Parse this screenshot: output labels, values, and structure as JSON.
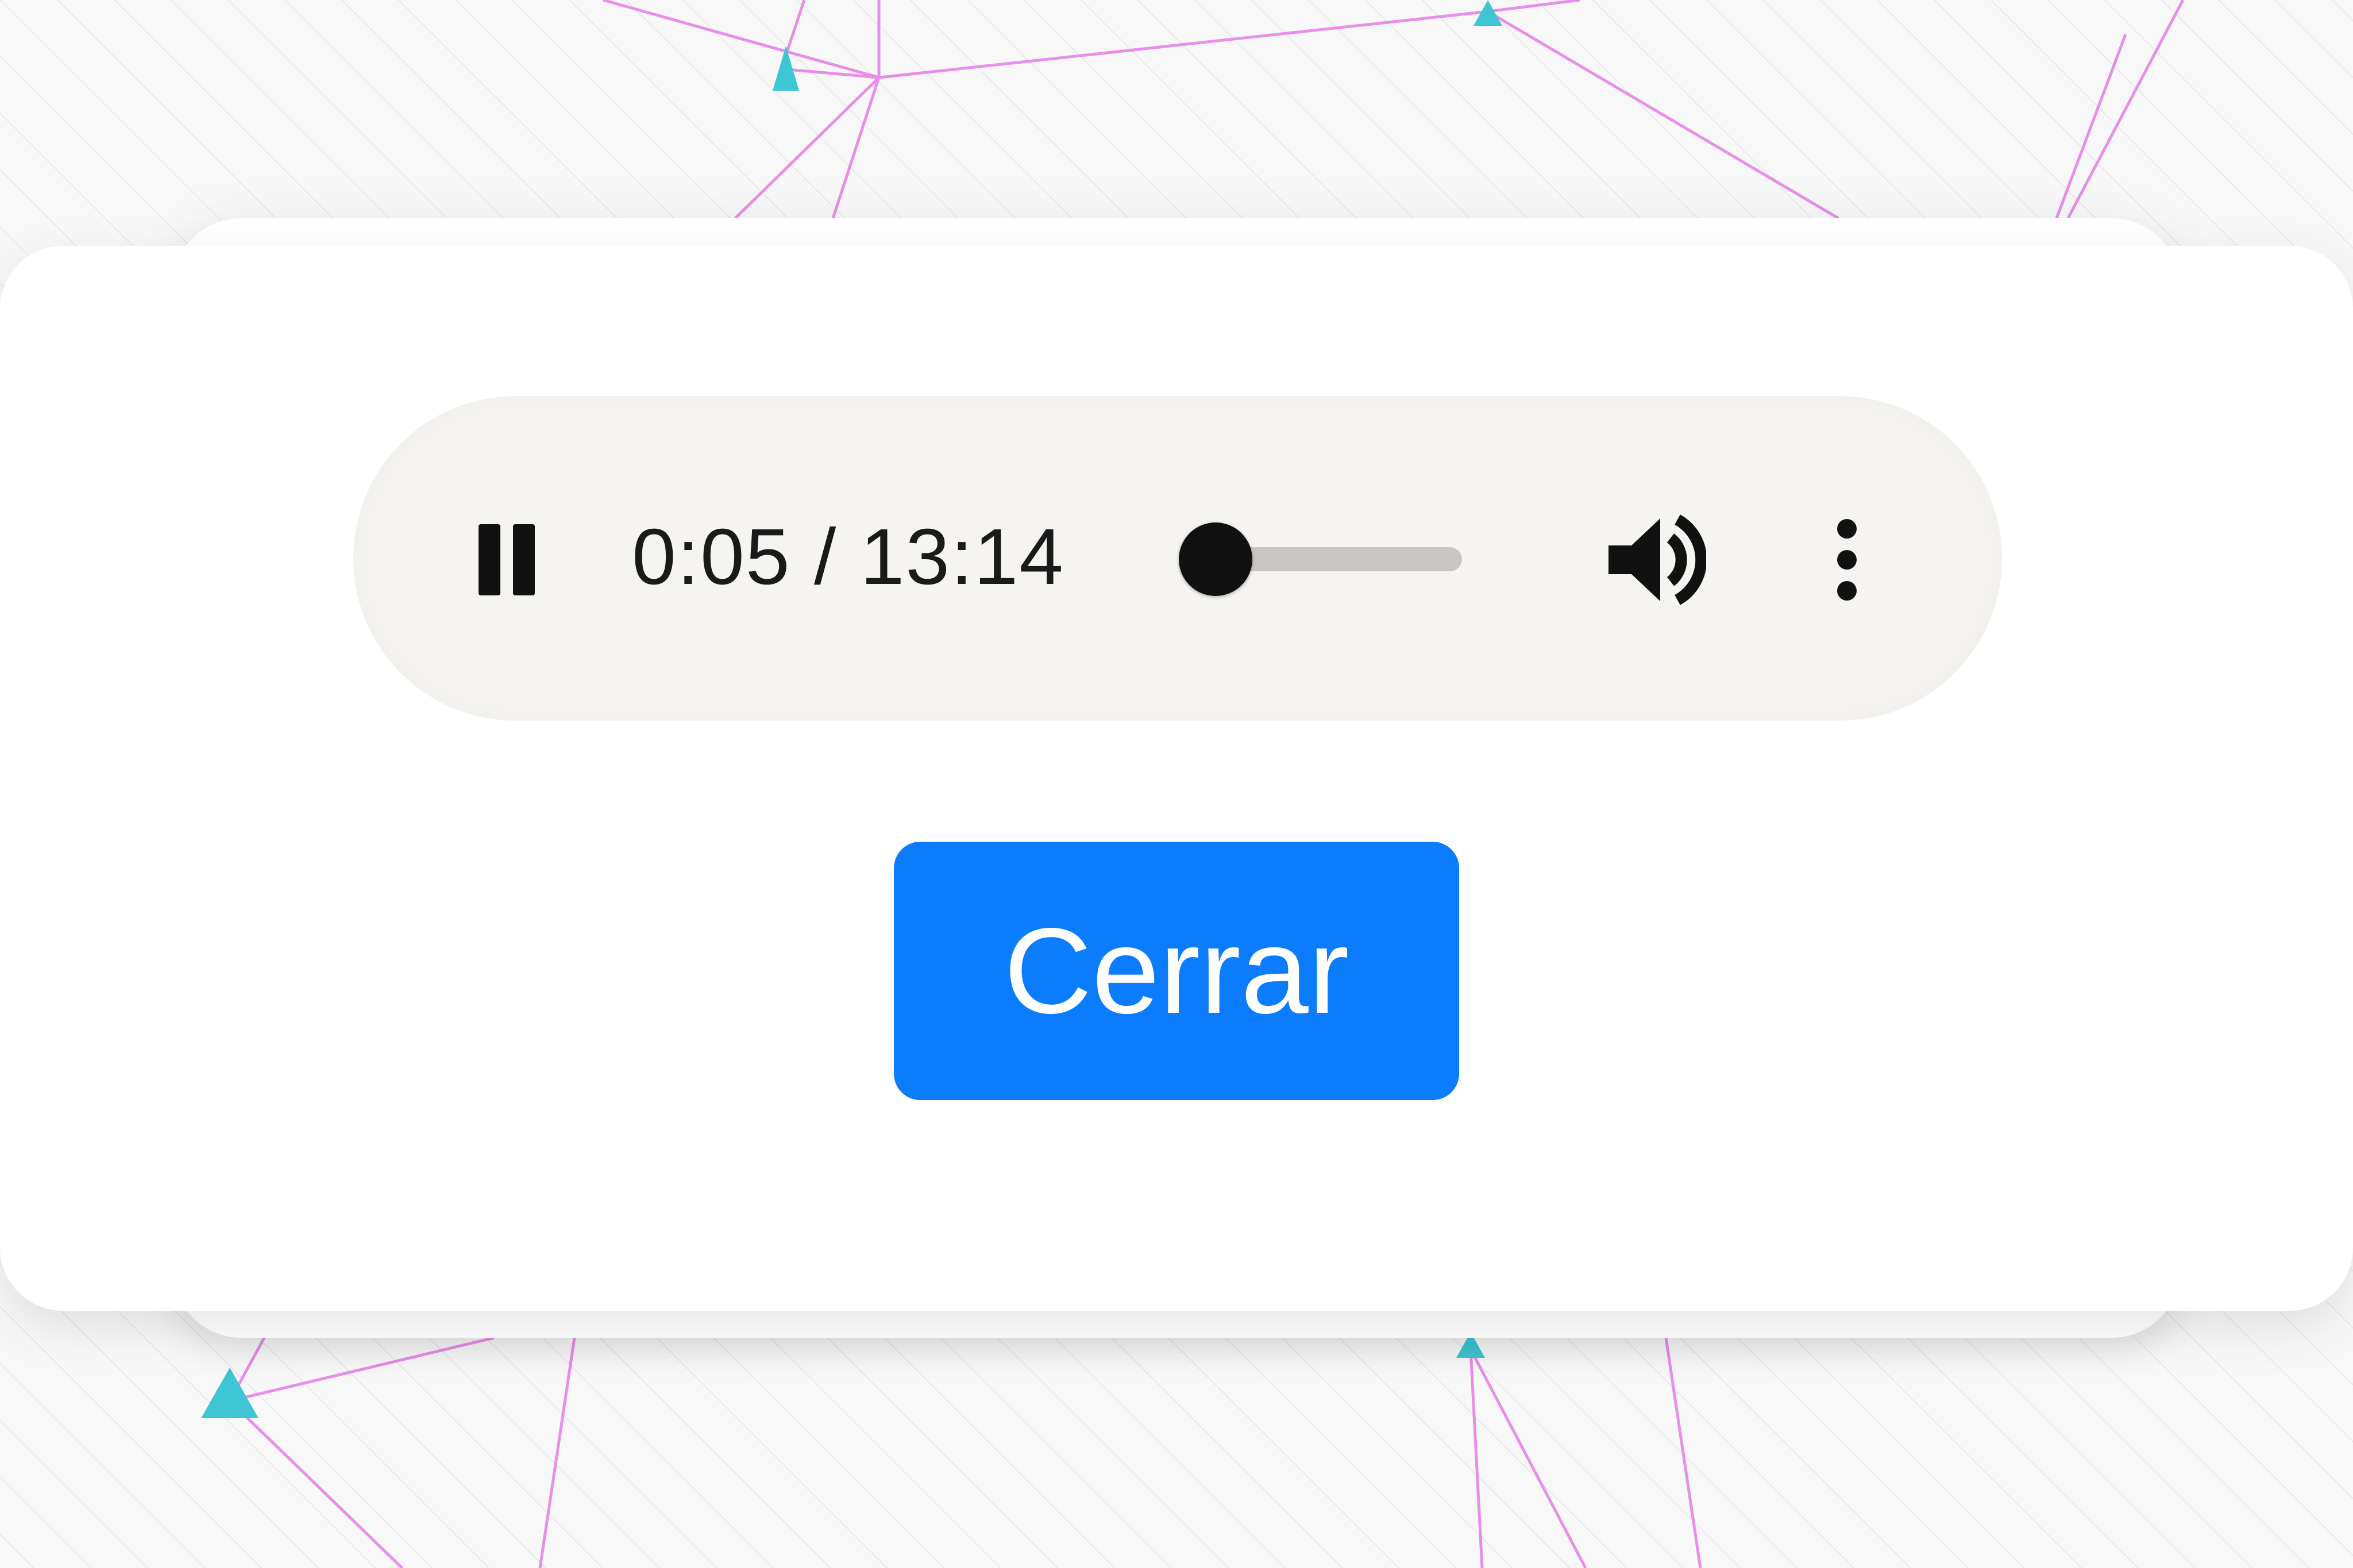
{
  "player": {
    "current_time": "0:05",
    "separator": " / ",
    "duration": "13:14",
    "time_text": "0:05 / 13:14",
    "progress_fraction": 0.006,
    "state": "playing",
    "icons": {
      "play_pause": "pause-icon",
      "volume": "volume-up-icon",
      "more": "more-vert-icon"
    }
  },
  "dialog": {
    "close_label": "Cerrar"
  },
  "colors": {
    "accent": "#0a7cfc",
    "player_bg": "#f6f4f0",
    "track": "#c9c6c3",
    "network_line": "#e36be6",
    "network_node": "#3ec6d4"
  }
}
